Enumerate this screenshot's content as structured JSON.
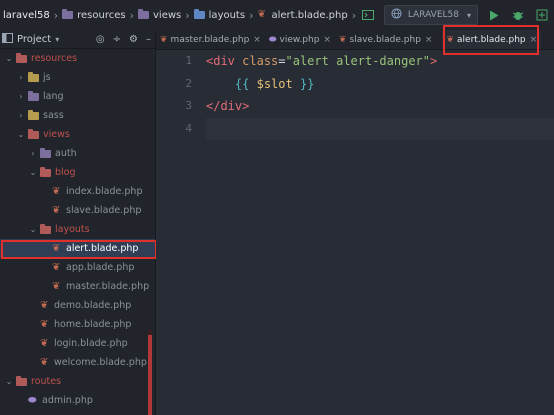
{
  "breadcrumb": [
    "laravel58",
    "resources",
    "views",
    "layouts",
    "alert.blade.php"
  ],
  "toolbar": {
    "config_name": "LARAVEL58",
    "icons": [
      "terminal-icon",
      "globe-icon",
      "chevron-down-icon",
      "run-icon",
      "debug-icon",
      "coverage-icon"
    ]
  },
  "sidebar": {
    "title": "Project",
    "items": [
      {
        "label": "resources",
        "depth": 1,
        "type": "folder",
        "expanded": true,
        "color": "red"
      },
      {
        "label": "js",
        "depth": 2,
        "type": "folder",
        "expanded": false,
        "color": "normal"
      },
      {
        "label": "lang",
        "depth": 2,
        "type": "folder",
        "expanded": false,
        "color": "normal"
      },
      {
        "label": "sass",
        "depth": 2,
        "type": "folder",
        "expanded": false,
        "color": "normal"
      },
      {
        "label": "views",
        "depth": 2,
        "type": "folder",
        "expanded": true,
        "color": "red"
      },
      {
        "label": "auth",
        "depth": 3,
        "type": "folder",
        "expanded": false,
        "color": "normal"
      },
      {
        "label": "blog",
        "depth": 3,
        "type": "folder",
        "expanded": true,
        "color": "red"
      },
      {
        "label": "index.blade.php",
        "depth": 4,
        "type": "file",
        "color": "normal"
      },
      {
        "label": "slave.blade.php",
        "depth": 4,
        "type": "file",
        "color": "normal"
      },
      {
        "label": "layouts",
        "depth": 3,
        "type": "folder",
        "expanded": true,
        "color": "red"
      },
      {
        "label": "alert.blade.php",
        "depth": 4,
        "type": "file",
        "color": "selected"
      },
      {
        "label": "app.blade.php",
        "depth": 4,
        "type": "file",
        "color": "normal"
      },
      {
        "label": "master.blade.php",
        "depth": 4,
        "type": "file",
        "color": "normal"
      },
      {
        "label": "demo.blade.php",
        "depth": 3,
        "type": "file",
        "color": "normal"
      },
      {
        "label": "home.blade.php",
        "depth": 3,
        "type": "file",
        "color": "normal"
      },
      {
        "label": "login.blade.php",
        "depth": 3,
        "type": "file",
        "color": "normal"
      },
      {
        "label": "welcome.blade.php",
        "depth": 3,
        "type": "file",
        "color": "normal"
      },
      {
        "label": "routes",
        "depth": 1,
        "type": "folder",
        "expanded": true,
        "color": "red"
      },
      {
        "label": "admin.php",
        "depth": 2,
        "type": "php",
        "color": "normal"
      }
    ]
  },
  "tabs": [
    {
      "label": "master.blade.php",
      "icon": "blade-icon",
      "active": false
    },
    {
      "label": "view.php",
      "icon": "php-icon",
      "active": false
    },
    {
      "label": "slave.blade.php",
      "icon": "blade-icon",
      "active": false
    },
    {
      "label": "alert.blade.php",
      "icon": "blade-icon",
      "active": true
    }
  ],
  "editor": {
    "line_numbers": [
      "1",
      "2",
      "3",
      "4"
    ],
    "code": {
      "l1_open": "<div",
      "l1_attr": "class",
      "l1_eq": "=",
      "l1_str": "\"alert alert-danger\"",
      "l1_close": ">",
      "l2_indent": "    ",
      "l2_open": "{{",
      "l2_var": "$slot",
      "l2_close": "}}",
      "l3_tag": "</div>"
    }
  },
  "colors": {
    "highlight_box": "#e0302b",
    "editor_bg": "#282c34",
    "sidebar_bg": "#21252b"
  }
}
